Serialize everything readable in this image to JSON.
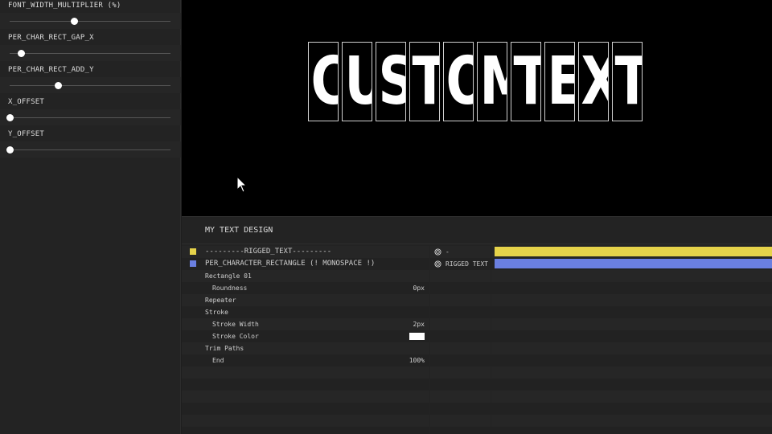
{
  "sliders": [
    {
      "label": "FONT_WIDTH_MULTIPLIER (%)",
      "position": 0.4
    },
    {
      "label": "PER_CHAR_RECT_GAP_X",
      "position": 0.07
    },
    {
      "label": "PER_CHAR_RECT_ADD_Y",
      "position": 0.3
    },
    {
      "label": "X_OFFSET",
      "position": 0.0
    },
    {
      "label": "Y_OFFSET",
      "position": 0.0
    }
  ],
  "preview": {
    "characters": [
      "C",
      "U",
      "S",
      "T",
      "O",
      "M",
      "T",
      "E",
      "X",
      "T"
    ]
  },
  "timeline": {
    "title": "MY TEXT DESIGN",
    "layers": [
      {
        "name": "---------RIGGED_TEXT---------",
        "color": "#e6d34a",
        "parent": "-",
        "parent_icon": "spiral-icon"
      },
      {
        "name": "PER_CHARACTER_RECTANGLE (! MONOSPACE !)",
        "color": "#6a7fe0",
        "parent": "RIGGED TEXT",
        "parent_icon": "spiral-icon"
      }
    ],
    "properties": [
      {
        "name": "Rectangle 01",
        "value": ""
      },
      {
        "name": "Roundness",
        "value": "0px"
      },
      {
        "name": "Repeater",
        "value": ""
      },
      {
        "name": "Stroke",
        "value": ""
      },
      {
        "name": "Stroke Width",
        "value": "2px"
      },
      {
        "name": "Stroke Color",
        "value": ""
      },
      {
        "name": "Trim Paths",
        "value": ""
      },
      {
        "name": "End",
        "value": "100%"
      }
    ]
  }
}
